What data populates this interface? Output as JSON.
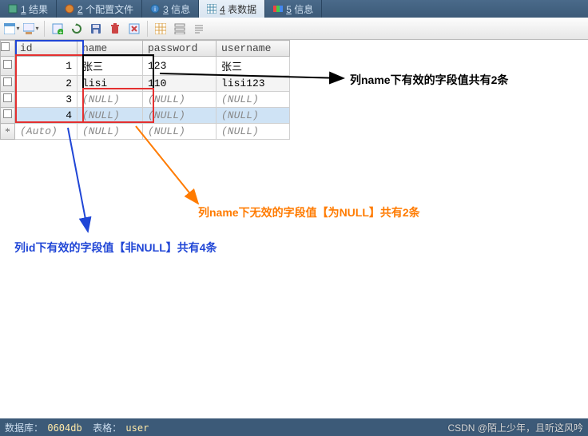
{
  "tabs": [
    {
      "num": "1",
      "label": "结果"
    },
    {
      "num": "2",
      "label": "个配置文件"
    },
    {
      "num": "3",
      "label": "信息"
    },
    {
      "num": "4",
      "label": "表数据"
    },
    {
      "num": "5",
      "label": "信息"
    }
  ],
  "active_tab": 3,
  "columns": [
    "id",
    "name",
    "password",
    "username"
  ],
  "rows": [
    {
      "id": "1",
      "name": "张三",
      "password": "123",
      "username": "张三",
      "sel": false,
      "alt": false
    },
    {
      "id": "2",
      "name": "lisi",
      "password": "110",
      "username": "lisi123",
      "sel": false,
      "alt": true
    },
    {
      "id": "3",
      "name": "(NULL)",
      "password": "(NULL)",
      "username": "(NULL)",
      "sel": false,
      "alt": false,
      "null": true
    },
    {
      "id": "4",
      "name": "(NULL)",
      "password": "(NULL)",
      "username": "(NULL)",
      "sel": true,
      "alt": true,
      "null": true
    },
    {
      "id": "(Auto)",
      "name": "(NULL)",
      "password": "(NULL)",
      "username": "(NULL)",
      "sel": false,
      "alt": false,
      "null": true,
      "auto": true
    }
  ],
  "annotations": {
    "black": "列name下有效的字段值共有2条",
    "orange": "列name下无效的字段值【为NULL】共有2条",
    "blue": "列id下有效的字段值【非NULL】共有4条"
  },
  "status": {
    "db_label": "数据库：",
    "db_value": "0604db",
    "tbl_label": "表格：",
    "tbl_value": "user"
  },
  "watermark": "CSDN @陌上少年，且听这风吟",
  "colors": {
    "black": "#000000",
    "orange": "#ff7b00",
    "blue": "#2046d6",
    "red": "#e43030"
  }
}
